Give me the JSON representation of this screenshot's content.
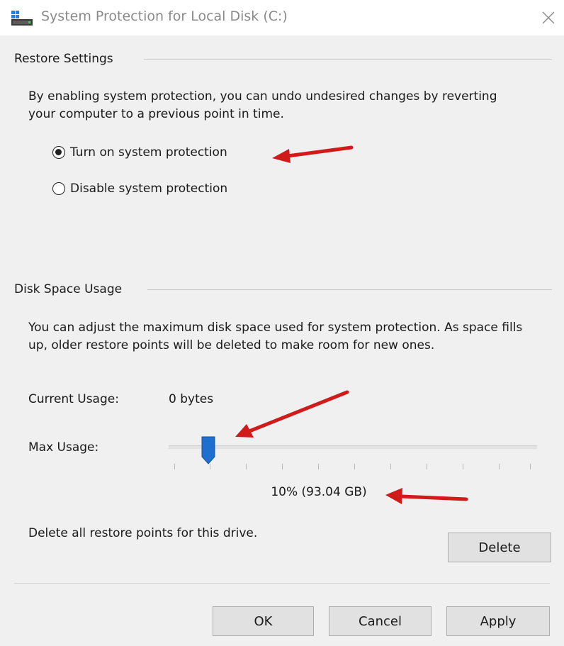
{
  "window": {
    "title": "System Protection for Local Disk (C:)",
    "icon": "drive-icon",
    "close_icon": "close-icon"
  },
  "restore_settings": {
    "heading": "Restore Settings",
    "description": "By enabling system protection, you can undo undesired changes by reverting your computer to a previous point in time.",
    "options": [
      {
        "label": "Turn on system protection",
        "selected": true
      },
      {
        "label": "Disable system protection",
        "selected": false
      }
    ]
  },
  "disk_space_usage": {
    "heading": "Disk Space Usage",
    "description": "You can adjust the maximum disk space used for system protection. As space fills up, older restore points will be deleted to make room for new ones.",
    "current_usage_label": "Current Usage:",
    "current_usage_value": "0 bytes",
    "max_usage_label": "Max Usage:",
    "max_usage_percent": 10,
    "max_usage_value": "10% (93.04 GB)",
    "delete_text": "Delete all restore points for this drive.",
    "delete_button": "Delete"
  },
  "buttons": {
    "ok": "OK",
    "cancel": "Cancel",
    "apply": "Apply"
  },
  "colors": {
    "slider_thumb": "#1e6fd0",
    "annotation_arrow": "#d11a1a"
  }
}
